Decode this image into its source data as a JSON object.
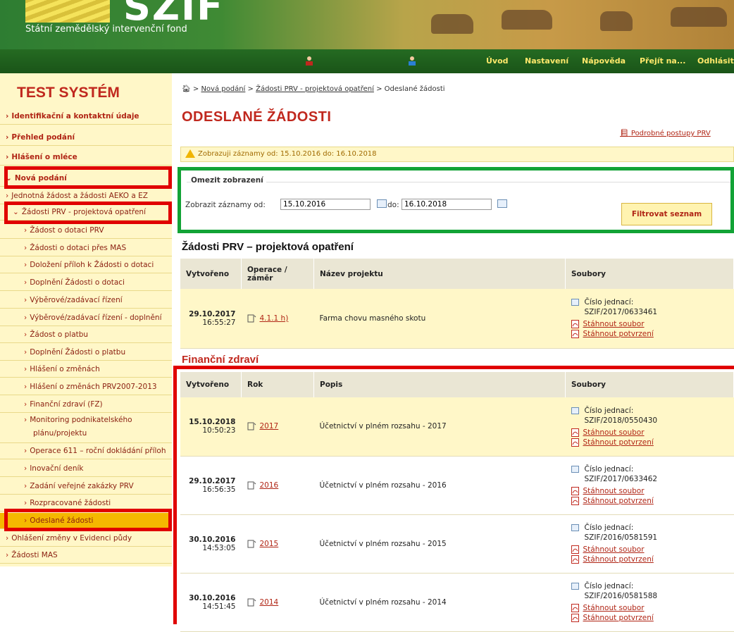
{
  "header": {
    "logo": "SZIF",
    "subtitle": "Státní zemědělský intervenční fond"
  },
  "nav": {
    "items": [
      "Úvod",
      "Nastavení",
      "Nápověda",
      "Přejít na...",
      "Odhlásit"
    ]
  },
  "sidebar": {
    "title": "TEST SYSTÉM",
    "items": [
      "Identifikační a kontaktní údaje",
      "Přehled podání",
      "Hlášení o mléce",
      "Nová podání",
      "Jednotná žádost a žádosti AEKO a EZ",
      "Žádosti PRV - projektová opatření",
      "Žádost o dotaci PRV",
      "Žádosti o dotaci přes MAS",
      "Doložení příloh k Žádosti o dotaci",
      "Doplnění Žádosti o dotaci",
      "Výběrové/zadávací řízení",
      "Výběrové/zadávací řízení - doplnění",
      "Žádost o platbu",
      "Doplnění Žádosti o platbu",
      "Hlášení o změnách",
      "Hlášení o změnách PRV2007-2013",
      "Finanční zdraví (FZ)",
      "Monitoring podnikatelského",
      "plánu/projektu",
      "Operace 611 – roční dokládání příloh",
      "Inovační deník",
      "Zadání veřejné zakázky PRV",
      "Rozpracované žádosti",
      "Odeslané žádosti",
      "Ohlášení změny v Evidenci půdy",
      "Žádosti MAS"
    ]
  },
  "breadcrumb": {
    "items": [
      "Nová podání",
      "Žádosti PRV - projektová opatření"
    ],
    "current": "Odeslané žádosti"
  },
  "page_title": "ODESLANÉ ŽÁDOSTI",
  "procedures_link": "Podrobné postupy PRV",
  "info_bar": "Zobrazuji záznamy od: 15.10.2016 do: 16.10.2018",
  "filter": {
    "legend": "Omezit zobrazení",
    "from_label": "Zobrazit záznamy od:",
    "from_value": "15.10.2016",
    "to_label": "do:",
    "to_value": "16.10.2018",
    "button": "Filtrovat seznam"
  },
  "prv": {
    "heading": "Žádosti PRV – projektová opatření",
    "headers": [
      "Vytvořeno",
      "Operace /",
      "záměr",
      "Název projektu",
      "Soubory"
    ],
    "rows": [
      {
        "date": "29.10.2017",
        "time": "16:55:27",
        "op": "4.1.1 h)",
        "name": "Farma chovu masného skotu",
        "ref_label": "Číslo jednací:",
        "ref": "SZIF/2017/0633461",
        "dl_file": "Stáhnout soubor",
        "dl_conf": "Stáhnout potvrzení"
      }
    ]
  },
  "fz": {
    "heading": "Finanční zdraví",
    "headers": [
      "Vytvořeno",
      "Rok",
      "Popis",
      "Soubory"
    ],
    "rows": [
      {
        "date": "15.10.2018",
        "time": "10:50:23",
        "year": "2017",
        "desc": "Účetnictví v plném rozsahu - 2017",
        "ref_label": "Číslo jednací:",
        "ref": "SZIF/2018/0550430",
        "dl_file": "Stáhnout soubor",
        "dl_conf": "Stáhnout potvrzení"
      },
      {
        "date": "29.10.2017",
        "time": "16:56:35",
        "year": "2016",
        "desc": "Účetnictví v plném rozsahu - 2016",
        "ref_label": "Číslo jednací:",
        "ref": "SZIF/2017/0633462",
        "dl_file": "Stáhnout soubor",
        "dl_conf": "Stáhnout potvrzení"
      },
      {
        "date": "30.10.2016",
        "time": "14:53:05",
        "year": "2015",
        "desc": "Účetnictví v plném rozsahu - 2015",
        "ref_label": "Číslo jednací:",
        "ref": "SZIF/2016/0581591",
        "dl_file": "Stáhnout soubor",
        "dl_conf": "Stáhnout potvrzení"
      },
      {
        "date": "30.10.2016",
        "time": "14:51:45",
        "year": "2014",
        "desc": "Účetnictví v plném rozsahu - 2014",
        "ref_label": "Číslo jednací:",
        "ref": "SZIF/2016/0581588",
        "dl_file": "Stáhnout soubor",
        "dl_conf": "Stáhnout potvrzení"
      }
    ]
  },
  "colors": {
    "brand_red": "#c0281e",
    "nav_green": "#1a5418",
    "highlight_box_red": "#e00000",
    "highlight_box_green": "#12a336",
    "active_menu": "#f5b800"
  }
}
